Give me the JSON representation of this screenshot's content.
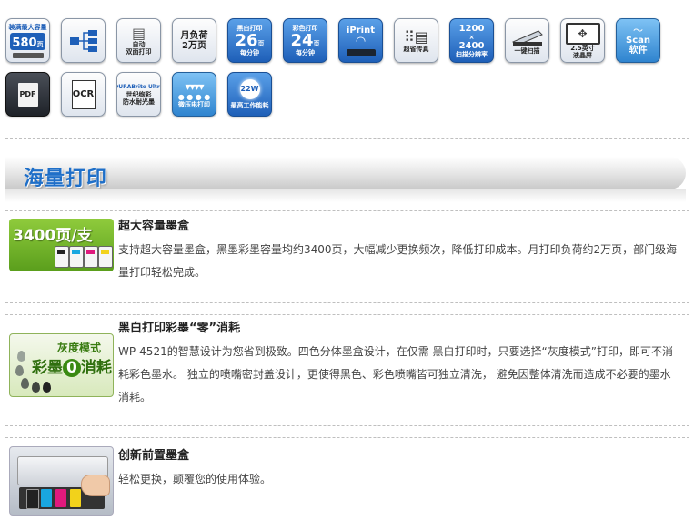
{
  "icons": {
    "row1": [
      {
        "name": "paper-capacity-580",
        "top": "装满最大容量",
        "big": "580",
        "unit": "页"
      },
      {
        "name": "network",
        "glyph": "▣"
      },
      {
        "name": "auto-duplex",
        "line1": "自动",
        "line2": "双面打印"
      },
      {
        "name": "monthly-duty",
        "line1": "月负荷",
        "line2": "2万页"
      },
      {
        "name": "mono-speed",
        "top": "黑白打印",
        "big": "26",
        "unit": "页",
        "bottom": "每分钟"
      },
      {
        "name": "color-speed",
        "top": "彩色打印",
        "big": "24",
        "unit": "页",
        "bottom": "每分钟"
      },
      {
        "name": "iprint",
        "label": "iPrint"
      },
      {
        "name": "fax",
        "label": "超省传真"
      },
      {
        "name": "scan-resolution",
        "line1": "1200",
        "sep": "×",
        "line2": "2400",
        "bottom": "扫描分辨率"
      },
      {
        "name": "one-touch-scan",
        "label": "一键扫描"
      },
      {
        "name": "lcd",
        "top": "2.5英寸",
        "label": "液晶屏"
      },
      {
        "name": "scan-software",
        "line1": "Scan",
        "line2": "软件"
      }
    ],
    "row2": [
      {
        "name": "pdf",
        "label": "PDF"
      },
      {
        "name": "ocr",
        "label": "OCR"
      },
      {
        "name": "durabrite",
        "top": "DURABrite Ultra",
        "line1": "世纪绚彩",
        "line2": "防水耐光墨"
      },
      {
        "name": "micro-piezo",
        "label": "微压电打印"
      },
      {
        "name": "power",
        "big": "22W",
        "label": "最高工作能耗"
      }
    ]
  },
  "section": {
    "title": "海量打印"
  },
  "features": [
    {
      "image_badge": "3400页/支",
      "title": "超大容量墨盒",
      "desc": "支持超大容量墨盒，黑墨彩墨容量均约3400页，大幅减少更换频次，降低打印成本。月打印负荷约2万页，部门级海量打印轻松完成。"
    },
    {
      "image_line1": "灰度模式",
      "image_line2a": "彩墨",
      "image_zero": "0",
      "image_line2b": "消耗",
      "title": "黑白打印彩墨“零”消耗",
      "desc": "WP-4521的智慧设计为您省到极致。四色分体墨盒设计，在仅需 黑白打印时，只要选择“灰度模式”打印，即可不消耗彩色墨水。 独立的喷嘴密封盖设计，更使得黑色、彩色喷嘴皆可独立清洗， 避免因整体清洗而造成不必要的墨水消耗。"
    },
    {
      "title": "创新前置墨盒",
      "desc": "轻松更换，颠覆您的使用体验。"
    }
  ],
  "colors": {
    "accent": "#1f6fc8",
    "ink_black": "#222222",
    "ink_cyan": "#19a7e0",
    "ink_magenta": "#e0197d",
    "ink_yellow": "#f2d21b"
  }
}
